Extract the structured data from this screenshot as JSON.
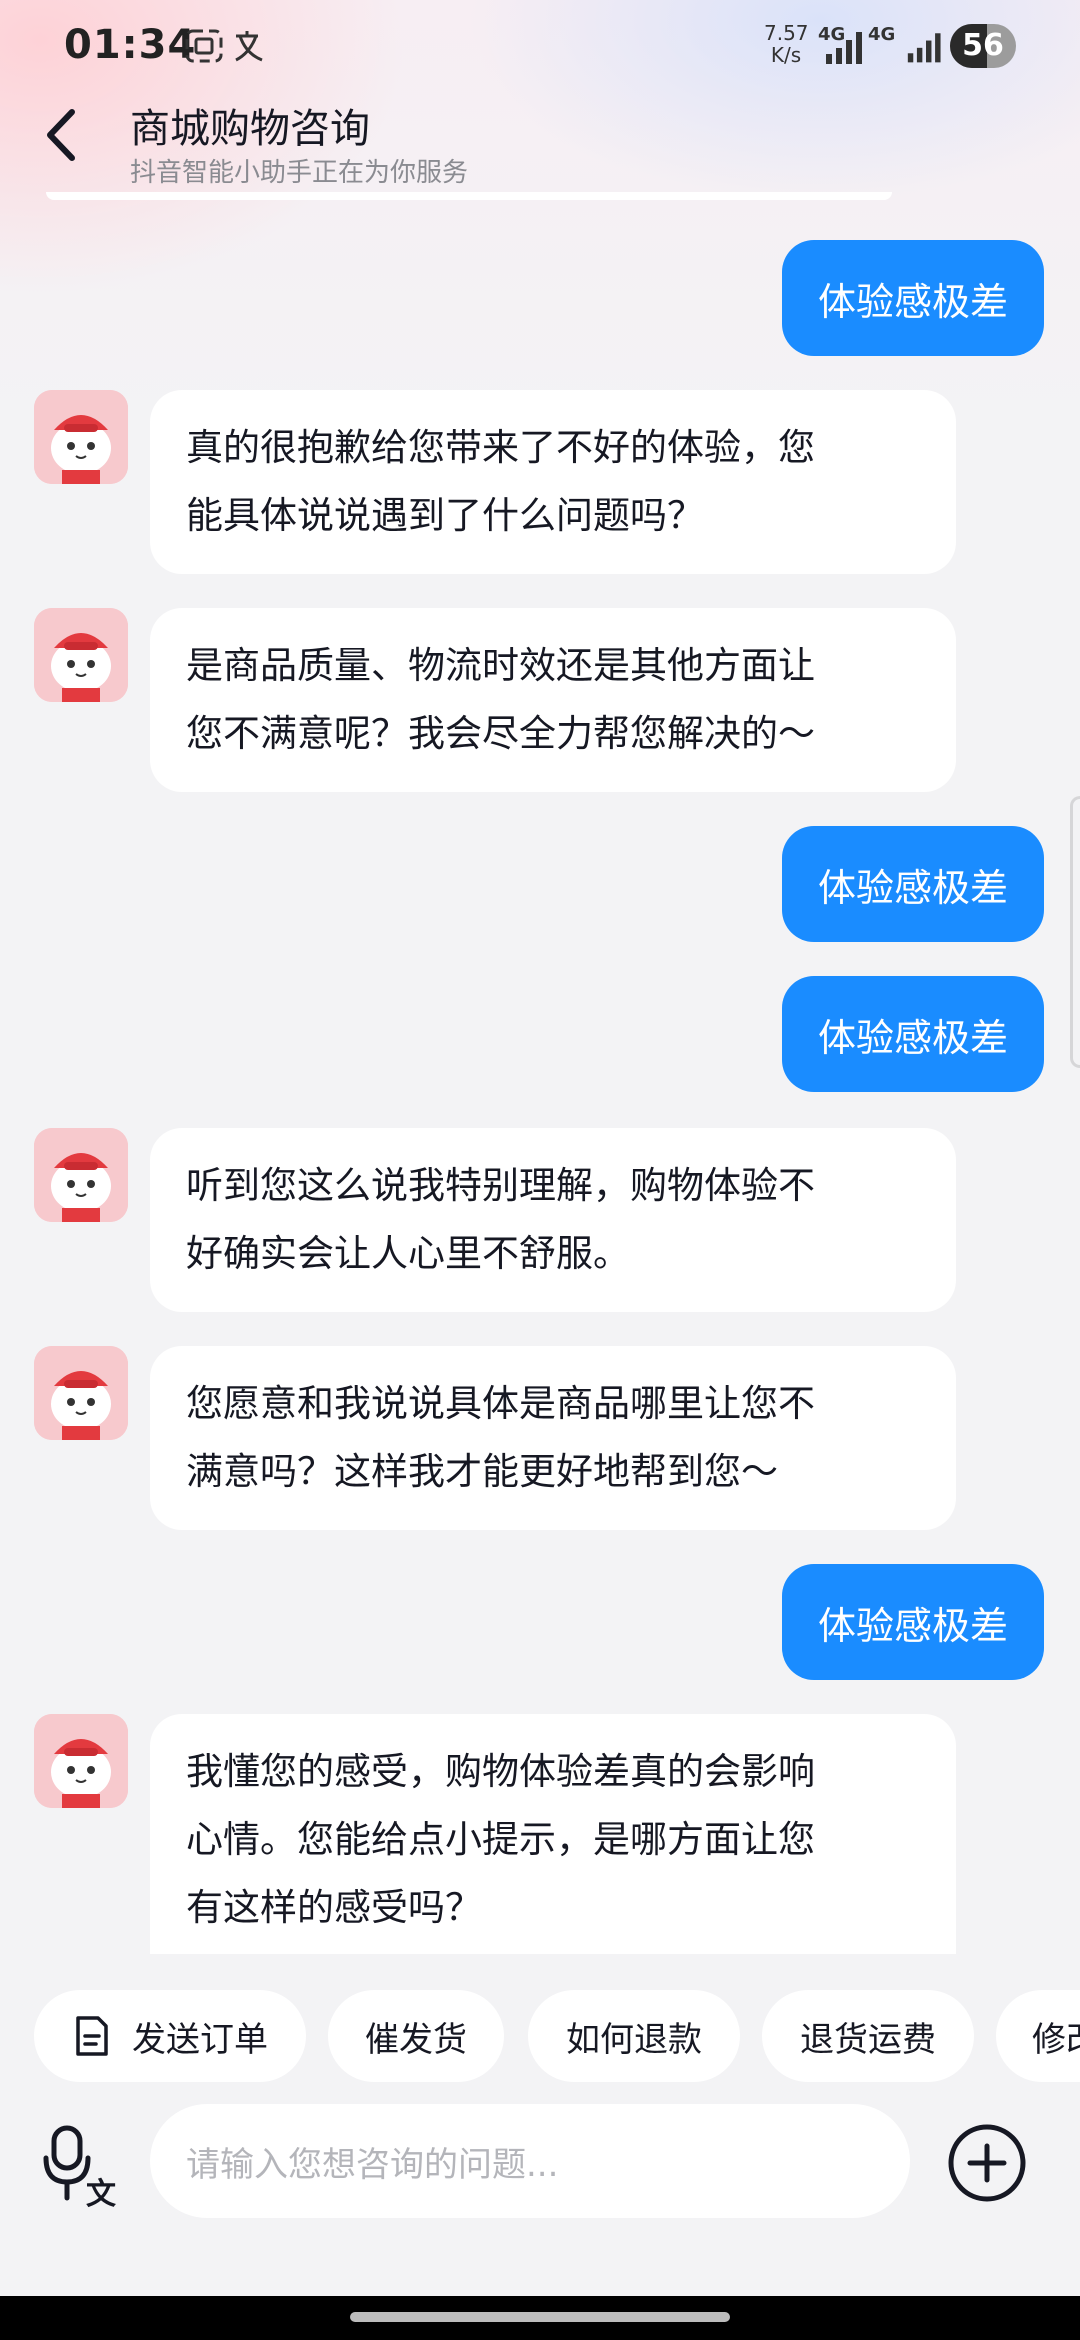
{
  "status_bar": {
    "time": "01:34",
    "net_speed_value": "7.57",
    "net_speed_unit": "K/s",
    "net1": "4G",
    "net2": "4G",
    "battery": "56"
  },
  "header": {
    "title": "商城购物咨询",
    "subtitle": "抖音智能小助手正在为你服务"
  },
  "messages": [
    {
      "from": "user",
      "text": "体验感极差"
    },
    {
      "from": "bot",
      "lines": [
        "真的很抱歉给您带来了不好的体验，您",
        "能具体说说遇到了什么问题吗？"
      ]
    },
    {
      "from": "bot",
      "lines": [
        "是商品质量、物流时效还是其他方面让",
        "您不满意呢？我会尽全力帮您解决的～"
      ]
    },
    {
      "from": "user",
      "text": "体验感极差"
    },
    {
      "from": "user",
      "text": "体验感极差"
    },
    {
      "from": "bot",
      "lines": [
        "听到您这么说我特别理解，购物体验不",
        "好确实会让人心里不舒服。"
      ]
    },
    {
      "from": "bot",
      "lines": [
        "您愿意和我说说具体是商品哪里让您不",
        "满意吗？这样我才能更好地帮到您～"
      ]
    },
    {
      "from": "user",
      "text": "体验感极差"
    },
    {
      "from": "bot",
      "lines": [
        "我懂您的感受，购物体验差真的会影响",
        "心情。您能给点小提示，是哪方面让您",
        "有这样的感受吗？"
      ]
    }
  ],
  "quick_actions": [
    "发送订单",
    "催发货",
    "如何退款",
    "退货运费",
    "修改"
  ],
  "input": {
    "placeholder": "请输入您想咨询的问题..."
  },
  "colors": {
    "user_bubble": "#1a8cff",
    "bot_bubble": "#ffffff",
    "background": "#f3f3f5"
  }
}
